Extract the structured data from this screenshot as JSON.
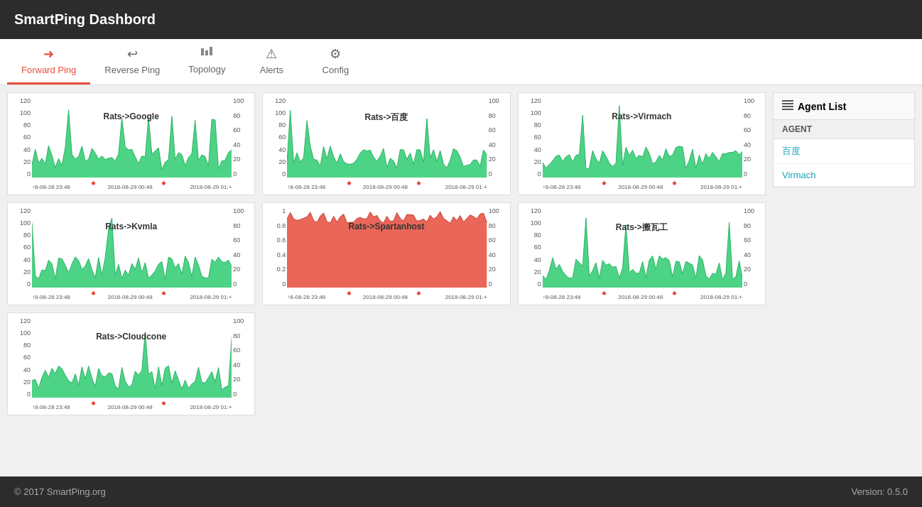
{
  "header": {
    "title": "SmartPing Dashbord"
  },
  "nav": {
    "items": [
      {
        "label": "Forward Ping",
        "icon": "➜",
        "active": true
      },
      {
        "label": "Reverse Ping",
        "icon": "↩",
        "active": false
      },
      {
        "label": "Topology",
        "icon": "📊",
        "active": false
      },
      {
        "label": "Alerts",
        "icon": "⚠",
        "active": false
      },
      {
        "label": "Config",
        "icon": "⚙",
        "active": false
      }
    ]
  },
  "charts": [
    {
      "id": "chart1",
      "title": "Rats->Google",
      "color": "#2ecc71",
      "row": 1
    },
    {
      "id": "chart2",
      "title": "Rats->百度",
      "color": "#2ecc71",
      "row": 1
    },
    {
      "id": "chart3",
      "title": "Rats->Virmach",
      "color": "#2ecc71",
      "row": 1
    },
    {
      "id": "chart4",
      "title": "Rats->Kvmla",
      "color": "#2ecc71",
      "row": 2
    },
    {
      "id": "chart5",
      "title": "Rats->Spartanhost",
      "color": "#e74c3c",
      "row": 2
    },
    {
      "id": "chart6",
      "title": "Rats->搬瓦工",
      "color": "#2ecc71",
      "row": 2
    },
    {
      "id": "chart7",
      "title": "Rats->Cloudcone",
      "color": "#2ecc71",
      "row": 3
    }
  ],
  "sidebar": {
    "header": "Agent List",
    "col_header": "AGENT",
    "items": [
      {
        "label": "百度"
      },
      {
        "label": "Virmach"
      }
    ]
  },
  "footer": {
    "copyright": "© 2017 SmartPing.org",
    "version": "Version: 0.5.0"
  },
  "x_labels": [
    "↑8-08-28 23:48",
    "2018-08-29 00:48",
    "2018-08-29 01:+"
  ]
}
